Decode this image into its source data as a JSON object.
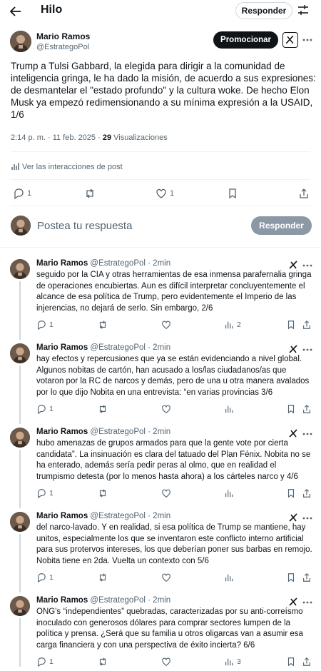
{
  "header": {
    "title": "Hilo",
    "reply_button": "Responder"
  },
  "main_post": {
    "author_name": "Mario Ramos",
    "author_handle": "@EstrategoPol",
    "promote_button": "Promocionar",
    "text": "Trump a Tulsi Gabbard, la elegida para dirigir a la comunidad de inteligencia gringa, le ha dado la misión, de acuerdo a sus expresiones: de desmantelar el \"estado profundo\" y la cultura woke.  De hecho Elon Musk ya empezó redimensionando a su mínima expresión a la USAID, 1/6",
    "time": "2:14 p. m. · 11 feb. 2025 · ",
    "views_count": "29",
    "views_label": "Visualizaciones",
    "interactions_link": "Ver las interacciones de post",
    "replies_count": "1",
    "likes_count": "1"
  },
  "compose": {
    "placeholder": "Postea tu respuesta",
    "button": "Responder"
  },
  "replies": [
    {
      "name": "Mario Ramos",
      "handle": "@EstrategoPol",
      "time": "· 2min",
      "text": "seguido por la CIA y otras herramientas de esa inmensa parafernalia gringa de operaciones encubiertas. Aun es difícil interpretar concluyentemente el alcance de esa política de Trump, pero evidentemente el Imperio de las injerencias, no dejará de serlo. Sin embargo, 2/6",
      "replies": "1",
      "views": "2"
    },
    {
      "name": "Mario Ramos",
      "handle": "@EstrategoPol",
      "time": "· 2min",
      "text": "hay efectos y repercusiones que ya se están evidenciando a nivel global. Algunos nobitas de cartón, han acusado a los/las ciudadanos/as que votaron por la RC de narcos y demás, pero de una u otra manera avalados por lo que dijo Nobita en una entrevista: “en varias provincias 3/6",
      "replies": "1",
      "views": ""
    },
    {
      "name": "Mario Ramos",
      "handle": "@EstrategoPol",
      "time": "· 2min",
      "text": "hubo amenazas de grupos armados para que la gente vote por cierta candidata”. La insinuación es clara del tatuado del Plan Fénix. Nobita no se ha enterado, además sería pedir peras al olmo, que en realidad el trumpismo detesta (por lo menos hasta ahora) a los cárteles narco y 4/6",
      "replies": "1",
      "views": ""
    },
    {
      "name": "Mario Ramos",
      "handle": "@EstrategoPol",
      "time": "· 2min",
      "text": "del narco-lavado. Y en realidad, si esa política de Trump se mantiene, hay unitos, especialmente los que se inventaron este conflicto interno artificial para sus protervos intereses, los que deberían poner sus barbas en remojo. Nobita tiene en 2da. Vuelta un contexto con 5/6",
      "replies": "1",
      "views": ""
    },
    {
      "name": "Mario Ramos",
      "handle": "@EstrategoPol",
      "time": "· 2min",
      "text": "ONG's “independientes” quebradas, caracterizadas por su anti-correísmo inoculado con generosos dólares para comprar sectores lumpen de la política y prensa. ¿Será que su familia u otros oligarcas van a asumir esa carga financiera y con una perspectiva de éxito incierta? 6/6",
      "replies": "1",
      "views": "3"
    }
  ],
  "icons": {
    "back": "back-arrow-icon",
    "tune": "tune-icon",
    "grok": "grok-icon",
    "more": "more-icon",
    "reply": "reply-icon",
    "repost": "repost-icon",
    "like": "like-icon",
    "views": "views-icon",
    "bookmark": "bookmark-icon",
    "share": "share-icon"
  }
}
